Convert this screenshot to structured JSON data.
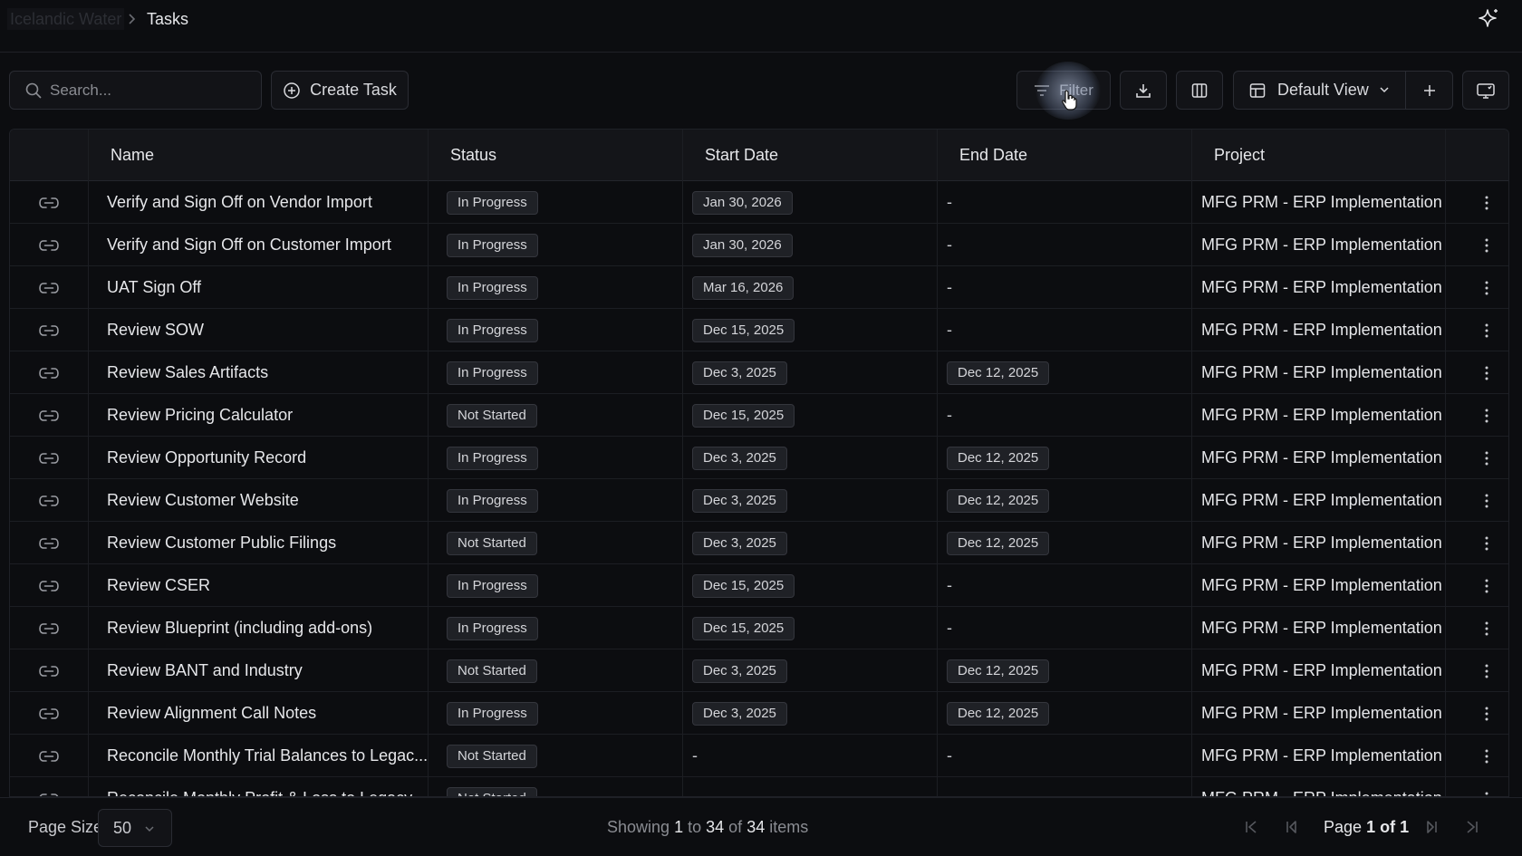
{
  "breadcrumb": {
    "root": "Icelandic Water",
    "current": "Tasks"
  },
  "toolbar": {
    "search_placeholder": "Search...",
    "create_label": "Create Task",
    "filter_label": "Filter",
    "view_label": "Default View"
  },
  "table": {
    "columns": {
      "name": "Name",
      "status": "Status",
      "start": "Start Date",
      "end": "End Date",
      "project": "Project"
    },
    "rows": [
      {
        "name": "Verify and Sign Off on Vendor Import",
        "status": "In Progress",
        "start": "Jan 30, 2026",
        "end": "-",
        "project": "MFG PRM - ERP Implementation"
      },
      {
        "name": "Verify and Sign Off on Customer Import",
        "status": "In Progress",
        "start": "Jan 30, 2026",
        "end": "-",
        "project": "MFG PRM - ERP Implementation"
      },
      {
        "name": "UAT Sign Off",
        "status": "In Progress",
        "start": "Mar 16, 2026",
        "end": "-",
        "project": "MFG PRM - ERP Implementation"
      },
      {
        "name": "Review SOW",
        "status": "In Progress",
        "start": "Dec 15, 2025",
        "end": "-",
        "project": "MFG PRM - ERP Implementation"
      },
      {
        "name": "Review Sales Artifacts",
        "status": "In Progress",
        "start": "Dec 3, 2025",
        "end": "Dec 12, 2025",
        "project": "MFG PRM - ERP Implementation"
      },
      {
        "name": "Review Pricing Calculator",
        "status": "Not Started",
        "start": "Dec 15, 2025",
        "end": "-",
        "project": "MFG PRM - ERP Implementation"
      },
      {
        "name": "Review Opportunity Record",
        "status": "In Progress",
        "start": "Dec 3, 2025",
        "end": "Dec 12, 2025",
        "project": "MFG PRM - ERP Implementation"
      },
      {
        "name": "Review Customer Website",
        "status": "In Progress",
        "start": "Dec 3, 2025",
        "end": "Dec 12, 2025",
        "project": "MFG PRM - ERP Implementation"
      },
      {
        "name": "Review Customer Public Filings",
        "status": "Not Started",
        "start": "Dec 3, 2025",
        "end": "Dec 12, 2025",
        "project": "MFG PRM - ERP Implementation"
      },
      {
        "name": "Review CSER",
        "status": "In Progress",
        "start": "Dec 15, 2025",
        "end": "-",
        "project": "MFG PRM - ERP Implementation"
      },
      {
        "name": "Review Blueprint (including add-ons)",
        "status": "In Progress",
        "start": "Dec 15, 2025",
        "end": "-",
        "project": "MFG PRM - ERP Implementation"
      },
      {
        "name": "Review BANT and Industry",
        "status": "Not Started",
        "start": "Dec 3, 2025",
        "end": "Dec 12, 2025",
        "project": "MFG PRM - ERP Implementation"
      },
      {
        "name": "Review Alignment Call Notes",
        "status": "In Progress",
        "start": "Dec 3, 2025",
        "end": "Dec 12, 2025",
        "project": "MFG PRM - ERP Implementation"
      },
      {
        "name": "Reconcile Monthly Trial Balances to Legac...",
        "status": "Not Started",
        "start": "-",
        "end": "-",
        "project": "MFG PRM - ERP Implementation"
      },
      {
        "name": "Reconcile Monthly Profit & Loss to Legacy...",
        "status": "Not Started",
        "start": "-",
        "end": "-",
        "project": "MFG PRM - ERP Implementation"
      }
    ]
  },
  "footer": {
    "page_size_label": "Page Size",
    "page_size_value": "50",
    "showing_prefix": "Showing",
    "showing_from": "1",
    "showing_to_word": "to",
    "showing_to": "34",
    "showing_of_word": "of",
    "showing_total": "34",
    "showing_suffix": "items",
    "page_word": "Page",
    "page_current": "1",
    "page_of_word": "of",
    "page_total": "1"
  },
  "colors": {
    "background": "#0c0d10",
    "pill_bg": "#1f2126",
    "border": "#2a2c33"
  },
  "icons": [
    "search-icon",
    "plus-circle-icon",
    "filter-icon",
    "download-icon",
    "columns-icon",
    "table-view-icon",
    "chevron-down-icon",
    "plus-icon",
    "monitor-icon",
    "link-icon",
    "more-vertical-icon",
    "sparkle-icon",
    "first-page-icon",
    "prev-page-icon",
    "next-page-icon",
    "last-page-icon"
  ]
}
